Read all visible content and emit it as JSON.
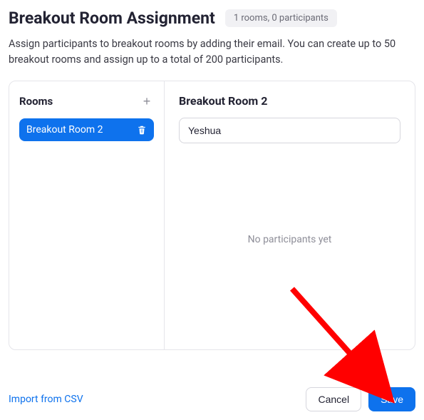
{
  "header": {
    "title": "Breakout Room Assignment",
    "badge": "1 rooms, 0 participants"
  },
  "description": "Assign participants to breakout rooms by adding their email. You can create up to 50 breakout rooms and assign up to a total of 200 participants.",
  "sidebar": {
    "title": "Rooms",
    "rooms": [
      {
        "name": "Breakout Room 2"
      }
    ]
  },
  "main": {
    "title": "Breakout Room 2",
    "input_value": "Yeshua",
    "empty_text": "No participants yet"
  },
  "footer": {
    "import_label": "Import from CSV",
    "cancel_label": "Cancel",
    "save_label": "Save"
  },
  "colors": {
    "accent": "#0e72ed",
    "arrow": "#ff0000"
  }
}
